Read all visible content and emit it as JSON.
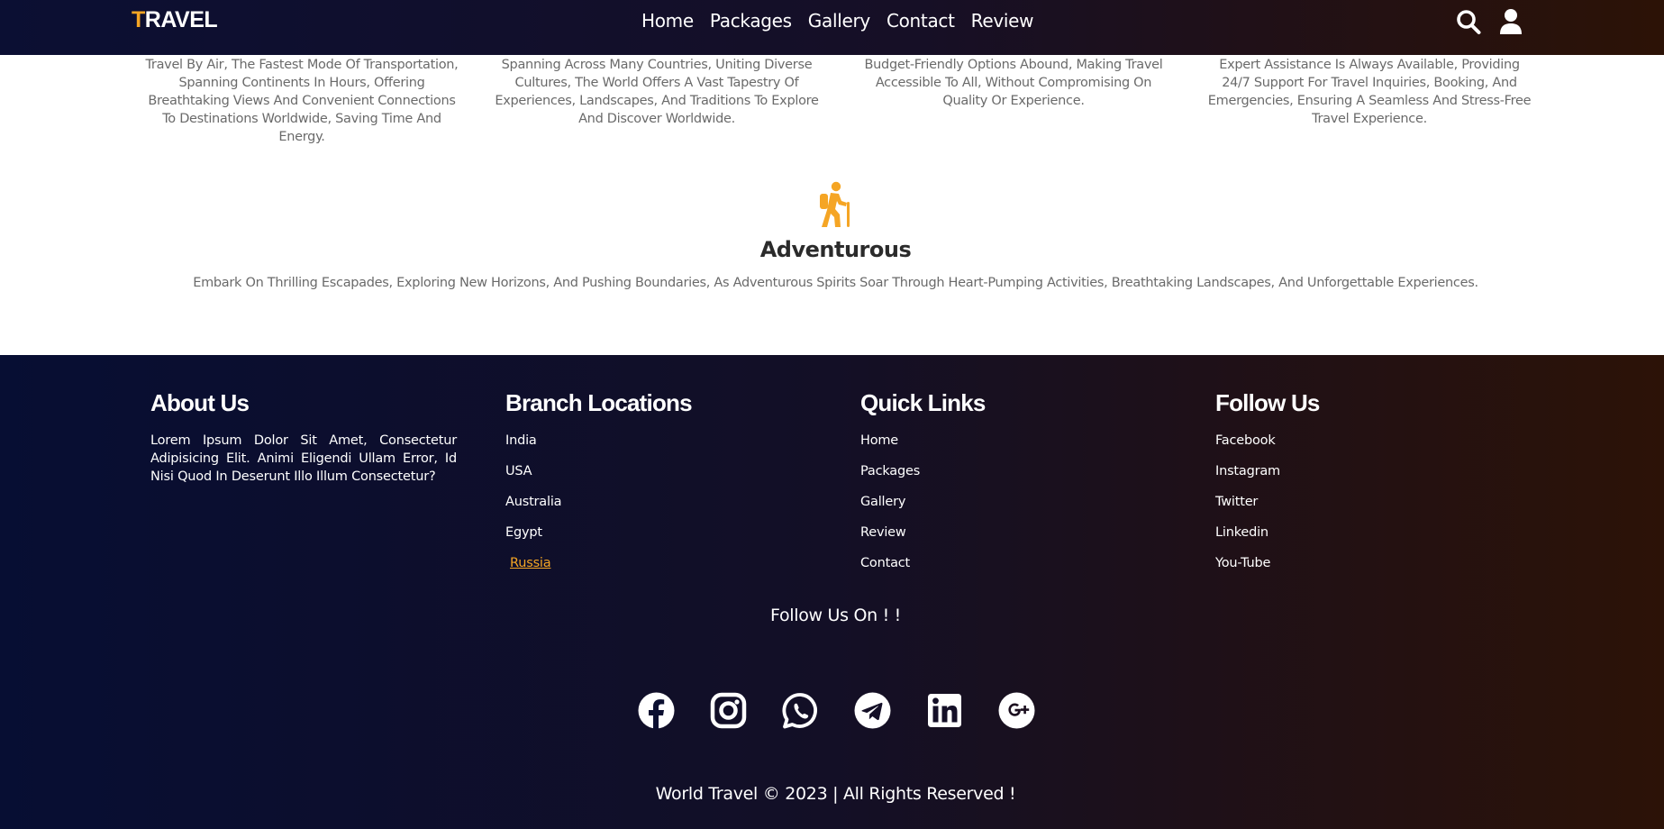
{
  "header": {
    "logo_first": "T",
    "logo_rest": "RAVEL",
    "nav": [
      "Home",
      "Packages",
      "Gallery",
      "Contact",
      "Review"
    ],
    "icons": [
      "search-icon",
      "user-icon"
    ]
  },
  "features": {
    "items": [
      {
        "desc": "Travel By Air, The Fastest Mode Of Transportation, Spanning Continents In Hours, Offering Breathtaking Views And Convenient Connections To Destinations Worldwide, Saving Time And Energy."
      },
      {
        "desc": "Spanning Across Many Countries, Uniting Diverse Cultures, The World Offers A Vast Tapestry Of Experiences, Landscapes, And Traditions To Explore And Discover Worldwide."
      },
      {
        "desc": "Budget-Friendly Options Abound, Making Travel Accessible To All, Without Compromising On Quality Or Experience."
      },
      {
        "desc": "Expert Assistance Is Always Available, Providing 24/7 Support For Travel Inquiries, Booking, And Emergencies, Ensuring A Seamless And Stress-Free Travel Experience."
      }
    ],
    "adventurous": {
      "icon": "hiking-icon",
      "title": "Adventurous",
      "desc": "Embark On Thrilling Escapades, Exploring New Horizons, And Pushing Boundaries, As Adventurous Spirits Soar Through Heart-Pumping Activities, Breathtaking Landscapes, And Unforgettable Experiences."
    }
  },
  "footer": {
    "about": {
      "title": "About Us",
      "text": "Lorem Ipsum Dolor Sit Amet, Consectetur Adipisicing Elit. Animi Eligendi Ullam Error, Id Nisi Quod In Deserunt Illo Illum Consectetur?"
    },
    "branches": {
      "title": "Branch Locations",
      "items": [
        "India",
        "USA",
        "Australia",
        "Egypt",
        "Russia"
      ]
    },
    "quick_links": {
      "title": "Quick Links",
      "items": [
        "Home",
        "Packages",
        "Gallery",
        "Review",
        "Contact"
      ]
    },
    "follow": {
      "title": "Follow Us",
      "items": [
        "Facebook",
        "Instagram",
        "Twitter",
        "Linkedin",
        "You-Tube"
      ]
    },
    "follow_on": "Follow Us On ! !",
    "social_icons": [
      "facebook-icon",
      "instagram-icon",
      "whatsapp-icon",
      "telegram-icon",
      "linkedin-icon",
      "google-plus-icon"
    ],
    "copyright": "World Travel © 2023 | All Rights Reserved !"
  },
  "colors": {
    "accent": "#f5a524",
    "footer_left": "#070e33",
    "footer_right": "#2c1207",
    "body_text": "#6a6a6a"
  }
}
